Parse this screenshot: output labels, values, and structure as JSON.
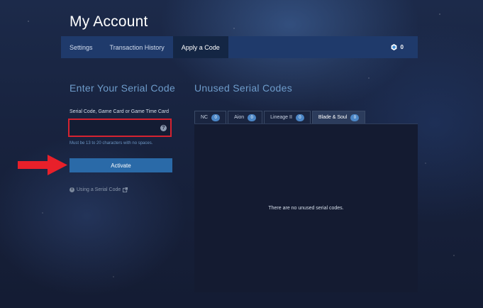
{
  "page_title": "My Account",
  "nav": {
    "tabs": [
      {
        "label": "Settings"
      },
      {
        "label": "Transaction History"
      },
      {
        "label": "Apply a Code",
        "active": true
      }
    ],
    "coin_count": "0"
  },
  "serial_form": {
    "section_title": "Enter Your Serial Code",
    "field_label": "Serial Code, Game Card or Game Time Card",
    "input_value": "",
    "help_icon": "?",
    "hint": "Must be 13 to 20 characters with no spaces.",
    "activate_label": "Activate",
    "help_link": "Using a Serial Code",
    "info_icon": "i"
  },
  "unused_codes": {
    "section_title": "Unused Serial Codes",
    "tabs": [
      {
        "label": "NC",
        "count": "0"
      },
      {
        "label": "Aion",
        "count": "0"
      },
      {
        "label": "Lineage II",
        "count": "0"
      },
      {
        "label": "Blade & Soul",
        "count": "0",
        "active": true
      }
    ],
    "empty_message": "There are no unused serial codes."
  },
  "colors": {
    "accent": "#2a6aa8",
    "nav_bg": "#1f3a6b",
    "highlight_border": "#d62330",
    "arrow": "#e8202a"
  },
  "icons": [
    "coin-icon",
    "help-icon",
    "info-icon",
    "external-link-icon",
    "red-arrow-icon"
  ]
}
